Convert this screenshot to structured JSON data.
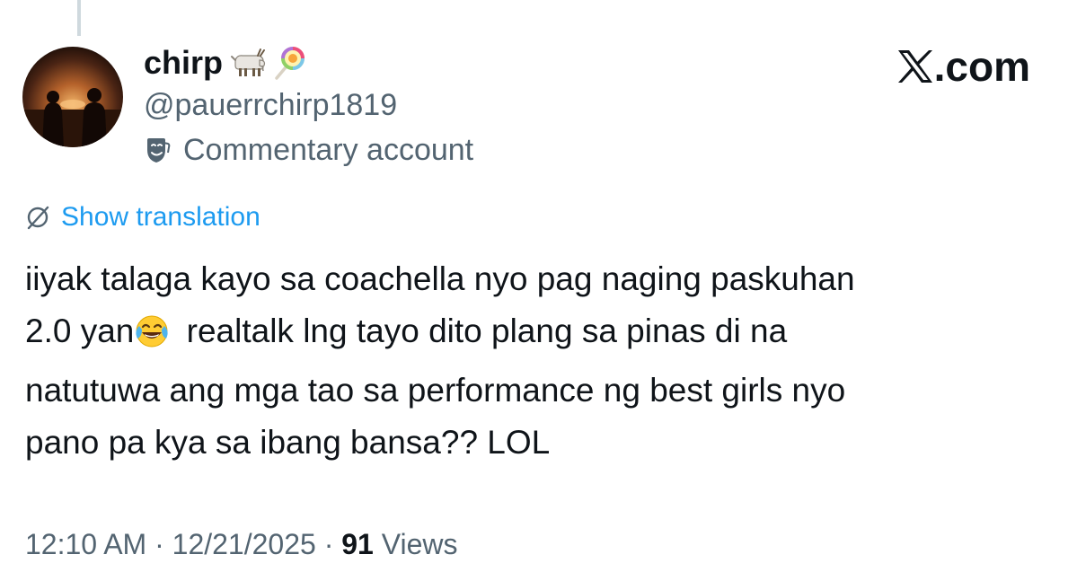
{
  "author": {
    "display_name": "chirp",
    "name_emojis": [
      "goat-emoji",
      "lollipop-emoji"
    ],
    "handle": "@pauerrchirp1819",
    "account_label": "Commentary account",
    "label_icon": "theater-masks-icon"
  },
  "brand": {
    "text": ".com",
    "logo_icon": "x-logo-icon"
  },
  "translation": {
    "label": "Show translation",
    "icon": "globe-icon"
  },
  "tweet": {
    "line1": "iiyak talaga kayo sa coachella nyo pag naging paskuhan",
    "line2_before_emoji": "2.0 yan",
    "line2_emoji": "face-with-tears-of-joy-emoji",
    "line2_after_emoji": " realtalk lng tayo dito plang sa pinas di na",
    "line3": "natutuwa ang mga tao sa performance ng best girls nyo",
    "line4": "pano pa kya sa ibang bansa?? LOL"
  },
  "meta": {
    "time": "12:10 AM",
    "separator": "·",
    "date": "12/21/2025",
    "views_count": "91",
    "views_label": "Views"
  },
  "colors": {
    "text": "#0f1419",
    "secondary": "#536471",
    "link": "#1d9bf0",
    "thread_line": "#cfd9de"
  }
}
